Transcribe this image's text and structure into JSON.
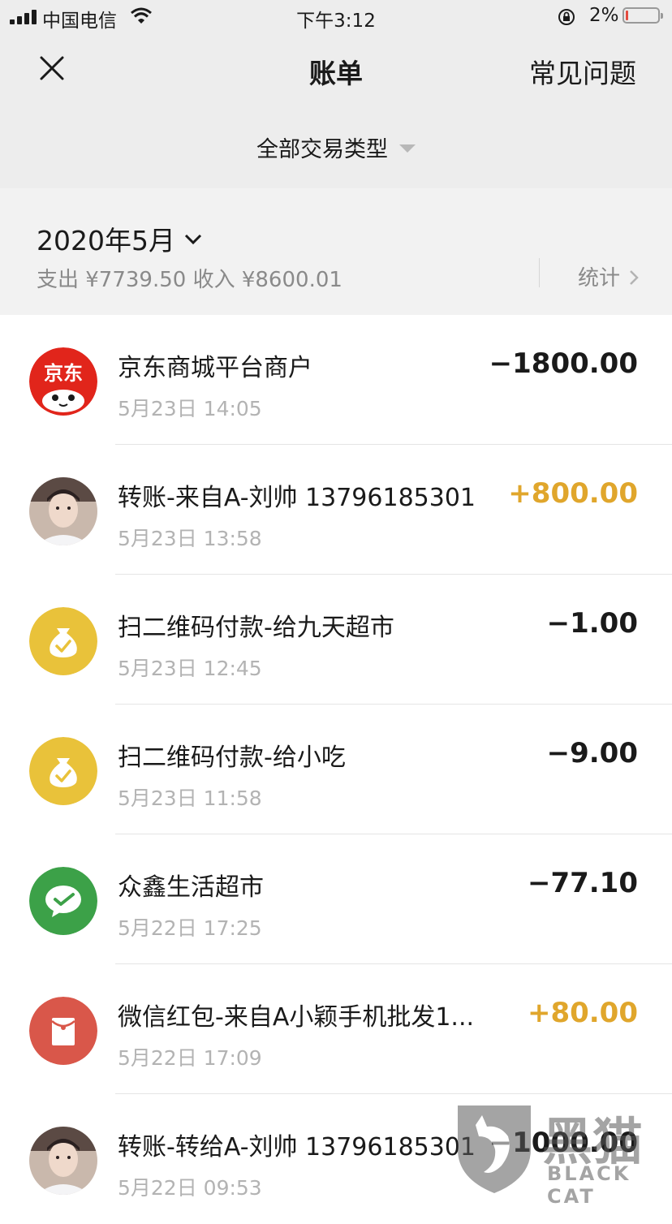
{
  "status_bar": {
    "carrier": "中国电信",
    "time": "下午3:12",
    "battery_percent": "2%",
    "battery_level": 0.02
  },
  "nav": {
    "title": "账单",
    "faq_label": "常见问题",
    "filter_label": "全部交易类型"
  },
  "summary": {
    "month": "2020年5月",
    "totals": "支出 ¥7739.50 收入 ¥8600.01",
    "stats_label": "统计"
  },
  "transactions": [
    {
      "name": "京东商城平台商户",
      "date": "5月23日 14:05",
      "amount": "−1800.00",
      "type": "expense",
      "icon": "jd-logo-icon"
    },
    {
      "name": "转账-来自A-刘帅 13796185301",
      "date": "5月23日 13:58",
      "amount": "+800.00",
      "type": "income",
      "icon": "user-avatar"
    },
    {
      "name": "扫二维码付款-给九天超市",
      "date": "5月23日 12:45",
      "amount": "−1.00",
      "type": "expense",
      "icon": "money-bag-icon"
    },
    {
      "name": "扫二维码付款-给小吃",
      "date": "5月23日 11:58",
      "amount": "−9.00",
      "type": "expense",
      "icon": "money-bag-icon"
    },
    {
      "name": "众鑫生活超市",
      "date": "5月22日 17:25",
      "amount": "−77.10",
      "type": "expense",
      "icon": "wechat-pay-icon"
    },
    {
      "name": "微信红包-来自A小颖手机批发1...",
      "date": "5月22日 17:09",
      "amount": "+80.00",
      "type": "income",
      "icon": "red-packet-icon"
    },
    {
      "name": "转账-转给A-刘帅 13796185301",
      "date": "5月22日 09:53",
      "amount": "−1000.00",
      "type": "expense",
      "icon": "user-avatar"
    }
  ],
  "watermark": {
    "cn": "黑猫",
    "en": "BLACK CAT"
  },
  "colors": {
    "income": "#e0a62c",
    "expense": "#1a1a1a",
    "header_bg": "#ededed",
    "summary_bg": "#f2f2f2"
  }
}
